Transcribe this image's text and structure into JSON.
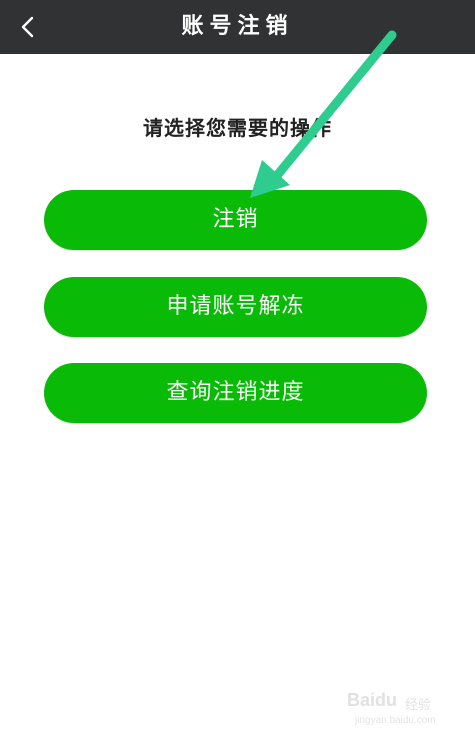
{
  "header": {
    "title": "账号注销",
    "back_icon": "chevron-left-icon",
    "background": "#303233"
  },
  "prompt": "请选择您需要的操作",
  "actions": [
    {
      "label": "注销"
    },
    {
      "label": "申请账号解冻"
    },
    {
      "label": "查询注销进度"
    }
  ],
  "accent_color": "#09bb07",
  "annotation": {
    "arrow_color": "#2ecc8f",
    "arrow_icon": "arrow-annotation-icon"
  },
  "watermark": {
    "logo": "Baidu",
    "sub": "经验",
    "url": "jingyan.baidu.com"
  }
}
